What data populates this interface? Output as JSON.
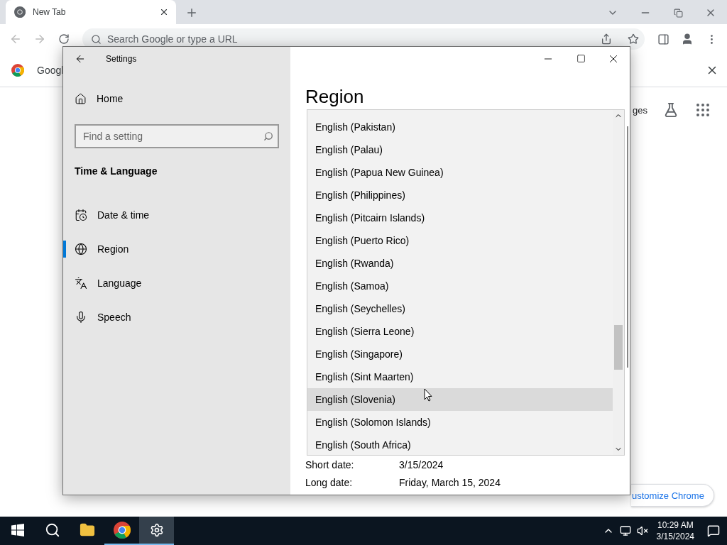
{
  "browser": {
    "tab": {
      "title": "New Tab",
      "selected": true
    },
    "omnibox": {
      "placeholder": "Search Google or type a URL"
    },
    "shortcut_label": "Googl",
    "page_text": "ges",
    "customize_button": "ustomize Chrome"
  },
  "settings": {
    "title": "Settings",
    "home": "Home",
    "search": {
      "placeholder": "Find a setting"
    },
    "section": "Time & Language",
    "nav": [
      {
        "label": "Date & time",
        "kind": "calendar",
        "selected": false
      },
      {
        "label": "Region",
        "kind": "globe",
        "selected": true
      },
      {
        "label": "Language",
        "kind": "language",
        "selected": false
      },
      {
        "label": "Speech",
        "kind": "mic",
        "selected": false
      }
    ],
    "heading": "Region",
    "dropdown": {
      "options": [
        {
          "label": "English (Pakistan)",
          "highlighted": false
        },
        {
          "label": "English (Palau)",
          "highlighted": false
        },
        {
          "label": "English (Papua New Guinea)",
          "highlighted": false
        },
        {
          "label": "English (Philippines)",
          "highlighted": false
        },
        {
          "label": "English (Pitcairn Islands)",
          "highlighted": false
        },
        {
          "label": "English (Puerto Rico)",
          "highlighted": false
        },
        {
          "label": "English (Rwanda)",
          "highlighted": false
        },
        {
          "label": "English (Samoa)",
          "highlighted": false
        },
        {
          "label": "English (Seychelles)",
          "highlighted": false
        },
        {
          "label": "English (Sierra Leone)",
          "highlighted": false
        },
        {
          "label": "English (Singapore)",
          "highlighted": false
        },
        {
          "label": "English (Sint Maarten)",
          "highlighted": false
        },
        {
          "label": "English (Slovenia)",
          "highlighted": true
        },
        {
          "label": "English (Solomon Islands)",
          "highlighted": false
        },
        {
          "label": "English (South Africa)",
          "highlighted": false
        }
      ]
    },
    "formats": [
      {
        "label": "Short date:",
        "value": "3/15/2024"
      },
      {
        "label": "Long date:",
        "value": "Friday, March 15, 2024"
      }
    ]
  },
  "taskbar": {
    "apps": [
      {
        "kind": "start",
        "running": false,
        "selected": false
      },
      {
        "kind": "search",
        "running": false,
        "selected": false
      },
      {
        "kind": "folder",
        "running": false,
        "selected": false
      },
      {
        "kind": "chrome",
        "running": true,
        "selected": false
      },
      {
        "kind": "settings",
        "running": true,
        "selected": true
      }
    ],
    "clock": {
      "time": "10:29 AM",
      "date": "3/15/2024"
    }
  }
}
